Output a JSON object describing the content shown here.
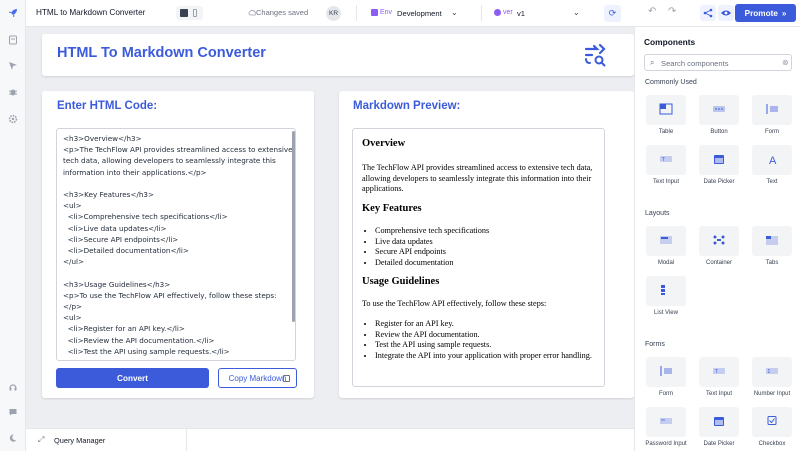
{
  "topbar": {
    "app_title": "HTML to Markdown Converter",
    "save_status": "Changes saved",
    "avatar_initials": "KR",
    "env_prefix": "Env",
    "env_value": "Development",
    "version_prefix": "ver",
    "version_value": "v1",
    "promote_label": "Promote"
  },
  "header_card": {
    "title": "HTML To Markdown Converter"
  },
  "input_card": {
    "title": "Enter HTML Code:",
    "code_lines": [
      "<h3>Overview</h3>",
      "<p>The TechFlow API provides streamlined access to extensive",
      "tech data, allowing developers to seamlessly integrate this",
      "information into their applications.</p>",
      "",
      "<h3>Key Features</h3>",
      "<ul>",
      "  <li>Comprehensive tech specifications</li>",
      "  <li>Live data updates</li>",
      "  <li>Secure API endpoints</li>",
      "  <li>Detailed documentation</li>",
      "</ul>",
      "",
      "<h3>Usage Guidelines</h3>",
      "<p>To use the TechFlow API effectively, follow these steps:",
      "</p>",
      "<ul>",
      "  <li>Register for an API key.</li>",
      "  <li>Review the API documentation.</li>",
      "  <li>Test the API using sample requests.</li>"
    ],
    "convert_label": "Convert",
    "copy_label": "Copy Markdown"
  },
  "preview_card": {
    "title": "Markdown Preview:",
    "h_overview": "Overview",
    "p_overview": "The TechFlow API provides streamlined access to extensive tech data, allowing developers to seamlessly integrate this information into their applications.",
    "h_features": "Key Features",
    "features": [
      "Comprehensive tech specifications",
      "Live data updates",
      "Secure API endpoints",
      "Detailed documentation"
    ],
    "h_usage": "Usage Guidelines",
    "p_usage": "To use the TechFlow API effectively, follow these steps:",
    "steps": [
      "Register for an API key.",
      "Review the API documentation.",
      "Test the API using sample requests.",
      "Integrate the API into your application with proper error handling."
    ]
  },
  "bottombar": {
    "query_manager_label": "Query Manager"
  },
  "panel": {
    "title": "Components",
    "search_placeholder": "Search components",
    "commonly_used_label": "Commonly Used",
    "commonly_used": [
      "Table",
      "Button",
      "Form",
      "Text Input",
      "Date Picker",
      "Text"
    ],
    "layouts_label": "Layouts",
    "layouts": [
      "Modal",
      "Container",
      "Tabs",
      "List View"
    ],
    "forms_label": "Forms",
    "forms": [
      "Form",
      "Text Input",
      "Number Input",
      "Password Input",
      "Date Picker",
      "Checkbox"
    ]
  },
  "colors": {
    "accent": "#3b5bdb",
    "header_text": "#3b5bdb",
    "canvas_bg": "#eceef1"
  }
}
